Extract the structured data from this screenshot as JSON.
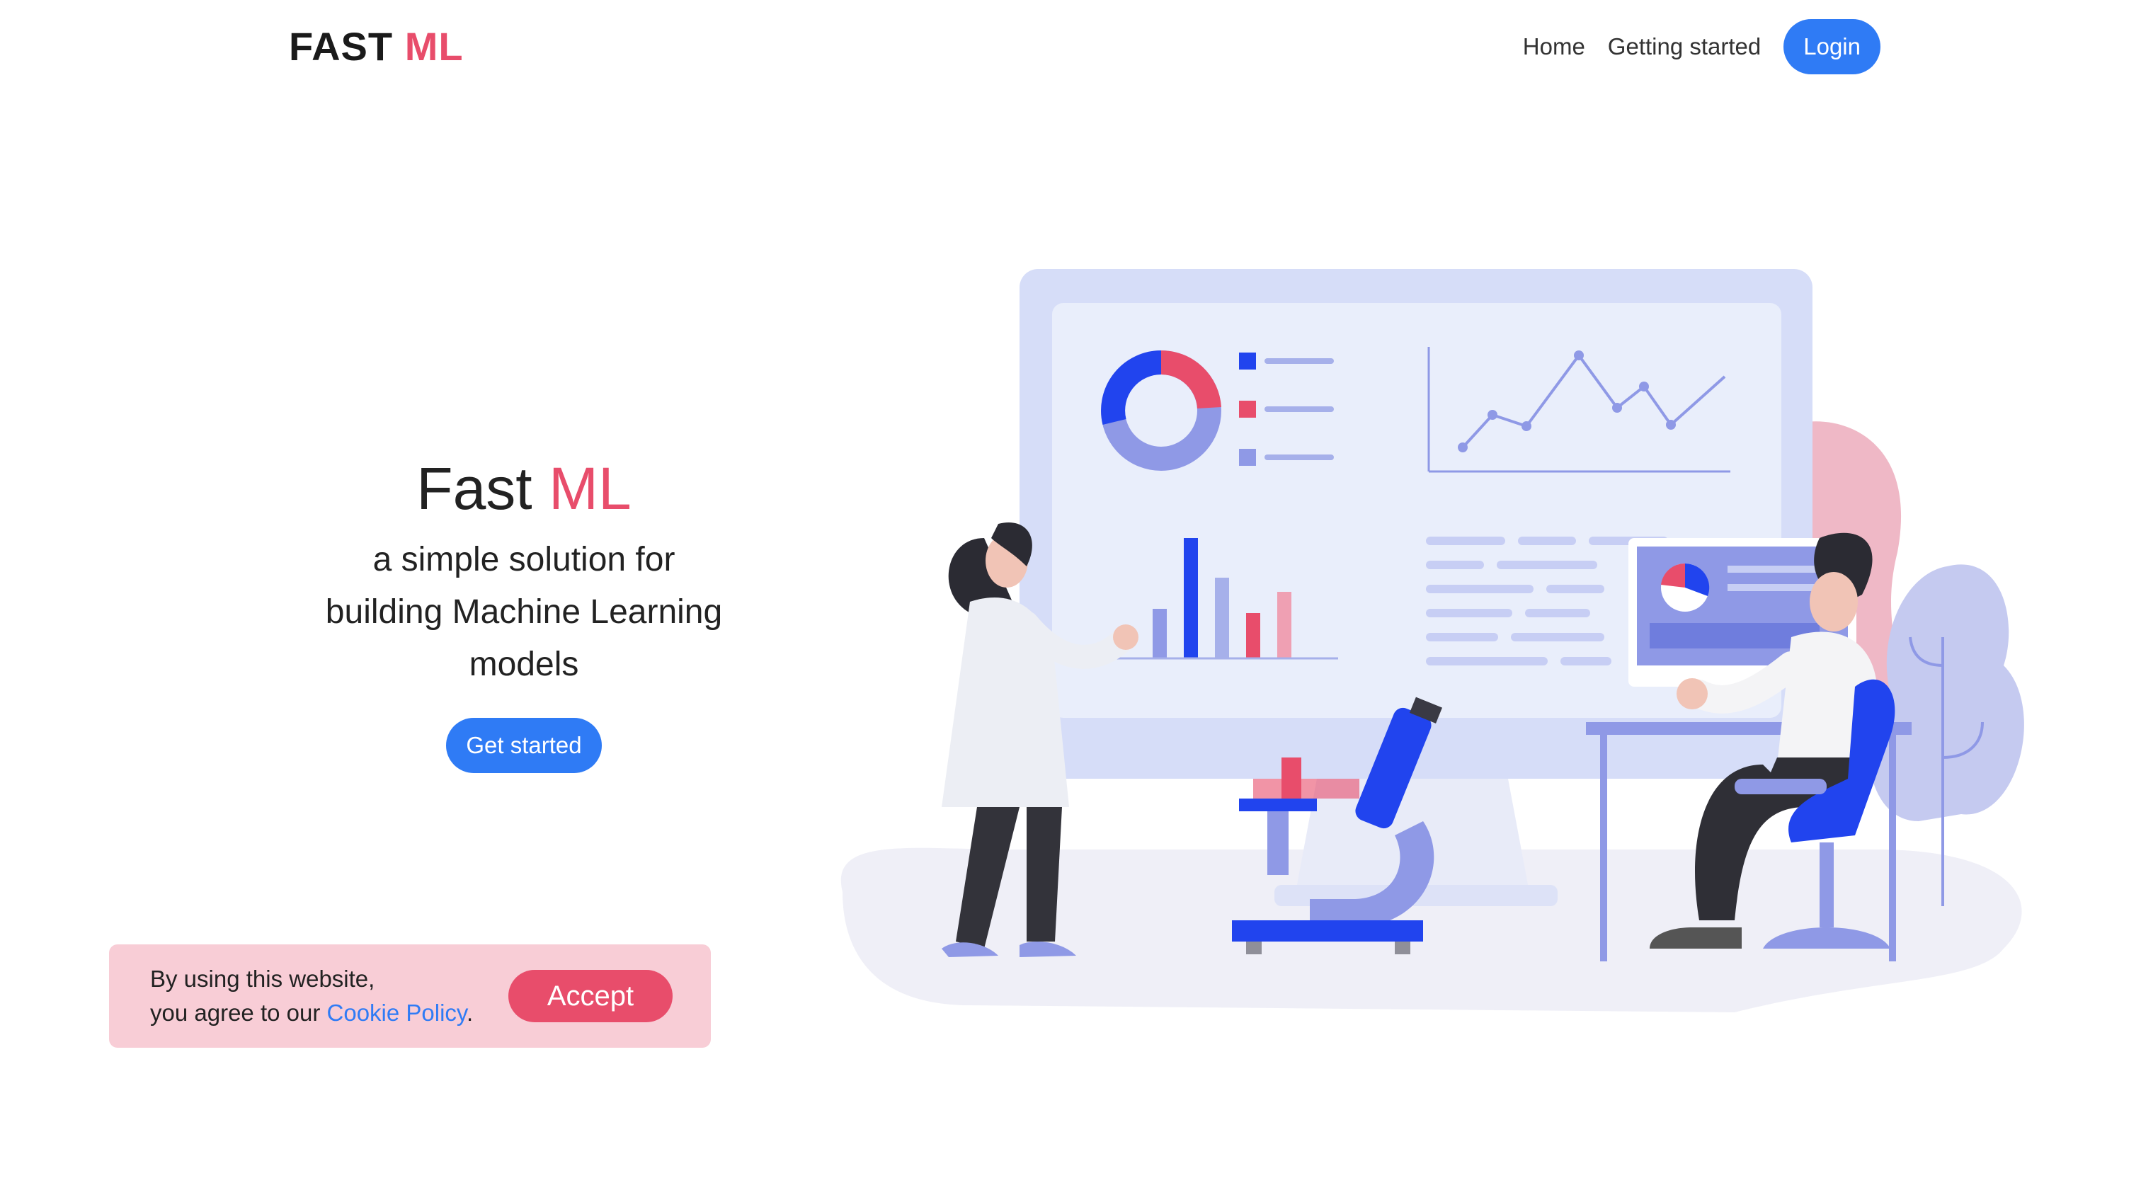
{
  "header": {
    "logo_part1": "FAST",
    "logo_part2": "ML",
    "nav": {
      "home": "Home",
      "getting_started": "Getting started",
      "login": "Login"
    }
  },
  "hero": {
    "title_part1": "Fast",
    "title_part2": "ML",
    "subtitle_line1": "a simple solution for",
    "subtitle_line2": "building Machine Learning",
    "subtitle_line3": "models",
    "cta": "Get started"
  },
  "cookie_banner": {
    "line1": "By using this website,",
    "line2_prefix": "you agree to our",
    "policy_link": "Cookie Policy",
    "line2_suffix": ".",
    "accept": "Accept"
  },
  "colors": {
    "accent_blue": "#2f7bf5",
    "accent_pink": "#e84d6b",
    "banner_bg": "#f8cdd6"
  },
  "illustration": {
    "icon": "data-science-illustration-icon"
  }
}
